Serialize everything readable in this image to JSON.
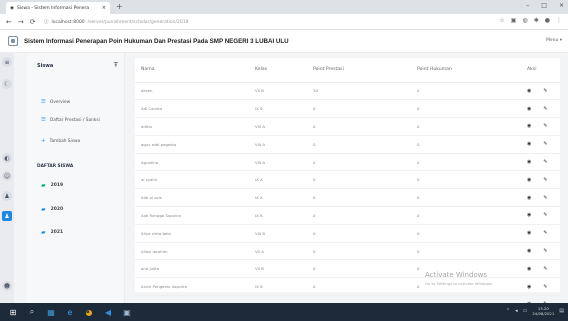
{
  "browser": {
    "tab_title": "Siswa - Sistem Informasi Penera",
    "tab_close": "×",
    "new_tab": "+",
    "window_controls": [
      "–",
      "□",
      "×"
    ],
    "url_host": "localhost:8000",
    "url_path": "/server/punishment/scholar/generation/2019"
  },
  "app": {
    "title": "Sistem Informasi Penerapan Poin Hukuman Dan Prestasi Pada SMP NEGERI 3 LUBAI ULU",
    "menu_label": "Menu ▾"
  },
  "sidebar": {
    "heading": "Siswa",
    "items": [
      {
        "label": "Overview",
        "icon": "list-icon"
      },
      {
        "label": "Daftar Prestasi / Sanksi",
        "icon": "list-icon"
      },
      {
        "label": "Tambah Siswa",
        "icon": "plus-icon"
      }
    ],
    "section": "DAFTAR SISWA",
    "years": [
      {
        "label": "2019",
        "color": "#00a878"
      },
      {
        "label": "2020",
        "color": "#1e88e5"
      },
      {
        "label": "2021",
        "color": "#1e88e5"
      }
    ]
  },
  "table": {
    "headers": [
      "Nama",
      "Kelas",
      "Point Prestasi",
      "Point Hukuman",
      "Aksi"
    ],
    "rows": [
      [
        "aksen",
        "VII B",
        "30",
        "0"
      ],
      [
        "Adi Candra",
        "IX B",
        "0",
        "0"
      ],
      [
        "aditia",
        "VIII A",
        "0",
        "0"
      ],
      [
        "agus widi pegesto",
        "VIII A",
        "0",
        "0"
      ],
      [
        "Agustina",
        "VIII A",
        "0",
        "0"
      ],
      [
        "al syahil",
        "IX A",
        "0",
        "0"
      ],
      [
        "Aldi al azis",
        "IX A",
        "0",
        "0"
      ],
      [
        "Aldi Rangga Saputra",
        "IX B",
        "0",
        "0"
      ],
      [
        "Aliya sinta bela",
        "VIII B",
        "0",
        "0"
      ],
      [
        "Allasi Ibrahim",
        "VII A",
        "0",
        "0"
      ],
      [
        "ana julita",
        "VII B",
        "0",
        "0"
      ],
      [
        "Andri Pengestu Saputra",
        "IX B",
        "0",
        "0"
      ],
      [
        "Angi Alamian",
        "IX B",
        "0",
        "0"
      ]
    ]
  },
  "watermark": {
    "line1": "Activate Windows",
    "line2": "Go to Settings to activate Windows."
  },
  "taskbar": {
    "time": "13.20",
    "date": "24/08/2021"
  }
}
